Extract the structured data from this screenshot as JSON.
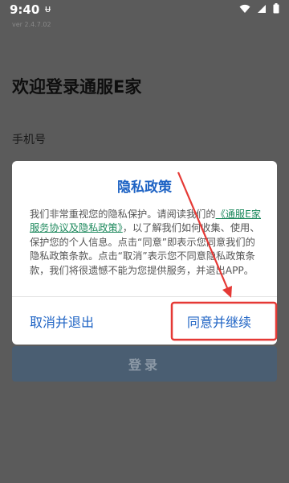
{
  "status_bar": {
    "time": "9:40",
    "notification_glyph": "ᵾ",
    "icons": [
      "wifi-icon",
      "signal-icon",
      "battery-icon"
    ]
  },
  "login_page": {
    "version": "ver 2.4.7.02",
    "title": "欢迎登录通服E家",
    "phone_label": "手机号",
    "login_button": "登录"
  },
  "dialog": {
    "title": "隐私政策",
    "body_before_link": "我们非常重视您的隐私保护。请阅读我们的",
    "link_text": "《通服E家服务协议及隐私政策》",
    "body_after_link": "，以了解我们如何收集、使用、保护您的个人信息。点击“同意”即表示您同意我们的隐私政策条款。点击“取消”表示您不同意隐私政策条款，我们将很遗憾不能为您提供服务，并退出APP。",
    "cancel_label": "取消并退出",
    "agree_label": "同意并继续"
  },
  "annotation": {
    "highlight_color": "#e53935"
  }
}
